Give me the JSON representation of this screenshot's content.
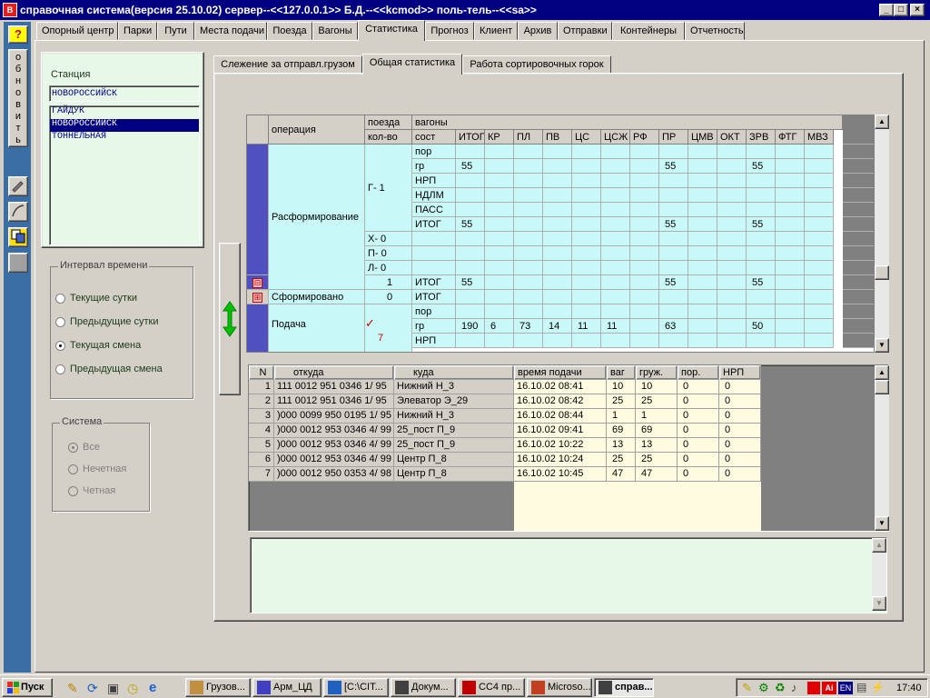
{
  "window": {
    "title": "справочная система(версия 25.10.02) сервер--<<127.0.0.1>> Б.Д.--<<kcmod>> поль-тель--<<sa>>",
    "controls": [
      "_",
      "□",
      "×"
    ]
  },
  "leftbar": {
    "help_label": "?",
    "refresh_label": "обновить"
  },
  "main_tabs": [
    "Опорный центр",
    "Парки",
    "Пути",
    "Места подачи",
    "Поезда",
    "Вагоны",
    "Статистика",
    "Прогноз",
    "Клиент",
    "Архив",
    "Отправки",
    "Контейнеры",
    "Отчетность"
  ],
  "active_main_tab": "Статистика",
  "station": {
    "label": "Станция",
    "value": "НОВОРОССИЙСК",
    "options": [
      "ГАЙДУК",
      "НОВОРОССИЙСК",
      "ТОННЕЛЬНАЯ"
    ],
    "selected": "НОВОРОССИЙСК"
  },
  "interval": {
    "caption": "Интервал времени",
    "options": [
      "Текущие сутки",
      "Предыдущие сутки",
      "Текущая смена",
      "Предыдущая смена"
    ],
    "selected": "Текущая смена"
  },
  "system": {
    "caption": "Система",
    "options": [
      "Все",
      "Нечетная",
      "Четная"
    ],
    "selected": "Все"
  },
  "sub_tabs": [
    "Слежение за отправл.грузом",
    "Общая статистика",
    "Работа сортировочных горок"
  ],
  "active_sub_tab": "Общая статистика",
  "stats": {
    "headers": {
      "operation": "операция",
      "trains": "поезда",
      "count": "кол-во",
      "wagons": "вагоны",
      "sost": "сост",
      "cols": [
        "ИТОГ",
        "КР",
        "ПЛ",
        "ПВ",
        "ЦС",
        "ЦСЖ",
        "РФ",
        "ПР",
        "ЦМВ",
        "ОКТ",
        "ЗРВ",
        "ФТГ",
        "МВЗ"
      ]
    },
    "groups": [
      {
        "operation": "Расформирование",
        "marker": "⊟"
      },
      {
        "operation": "Сформировано",
        "marker": "⊞"
      },
      {
        "operation": "Подача",
        "marker": ""
      }
    ],
    "train_counts": {
      "g": "Г-  1",
      "x": "Х-  0",
      "p": "П-  0",
      "l": "Л-  0",
      "rasform_total": "1",
      "sform_total": "0",
      "podacha_total": "7",
      "check": "✓"
    },
    "rows": [
      {
        "sost": "пор",
        "vals": [
          "",
          "",
          "",
          "",
          "",
          "",
          "",
          "",
          "",
          "",
          "",
          "",
          ""
        ]
      },
      {
        "sost": "гр",
        "vals": [
          "55",
          "",
          "",
          "",
          "",
          "",
          "",
          "55",
          "",
          "",
          "55",
          "",
          ""
        ]
      },
      {
        "sost": "НРП",
        "vals": [
          "",
          "",
          "",
          "",
          "",
          "",
          "",
          "",
          "",
          "",
          "",
          "",
          ""
        ]
      },
      {
        "sost": "НДЛМ",
        "vals": [
          "",
          "",
          "",
          "",
          "",
          "",
          "",
          "",
          "",
          "",
          "",
          "",
          ""
        ]
      },
      {
        "sost": "ПАСС",
        "vals": [
          "",
          "",
          "",
          "",
          "",
          "",
          "",
          "",
          "",
          "",
          "",
          "",
          ""
        ]
      },
      {
        "sost": "ИТОГ",
        "vals": [
          "55",
          "",
          "",
          "",
          "",
          "",
          "",
          "55",
          "",
          "",
          "55",
          "",
          ""
        ]
      },
      {
        "sost": "",
        "vals": [
          "",
          "",
          "",
          "",
          "",
          "",
          "",
          "",
          "",
          "",
          "",
          "",
          ""
        ]
      },
      {
        "sost": "",
        "vals": [
          "",
          "",
          "",
          "",
          "",
          "",
          "",
          "",
          "",
          "",
          "",
          "",
          ""
        ]
      },
      {
        "sost": "",
        "vals": [
          "",
          "",
          "",
          "",
          "",
          "",
          "",
          "",
          "",
          "",
          "",
          "",
          ""
        ]
      },
      {
        "sost": "ИТОГ",
        "vals": [
          "55",
          "",
          "",
          "",
          "",
          "",
          "",
          "55",
          "",
          "",
          "55",
          "",
          ""
        ]
      },
      {
        "sost": "ИТОГ",
        "vals": [
          "",
          "",
          "",
          "",
          "",
          "",
          "",
          "",
          "",
          "",
          "",
          "",
          ""
        ]
      },
      {
        "sost": "пор",
        "vals": [
          "",
          "",
          "",
          "",
          "",
          "",
          "",
          "",
          "",
          "",
          "",
          "",
          ""
        ]
      },
      {
        "sost": "гр",
        "vals": [
          "190",
          "6",
          "73",
          "14",
          "11",
          "11",
          "",
          "63",
          "",
          "",
          "50",
          "",
          ""
        ]
      },
      {
        "sost": "НРП",
        "vals": [
          "",
          "",
          "",
          "",
          "",
          "",
          "",
          "",
          "",
          "",
          "",
          "",
          ""
        ]
      }
    ]
  },
  "detail": {
    "headers": [
      "N",
      "откуда",
      "куда",
      "время подачи",
      "ваг",
      "груж.",
      "пор.",
      "НРП"
    ],
    "rows": [
      [
        "1",
        "111 0012 951 0346  1/ 95",
        "Нижний      Н_3",
        "16.10.02 08:41",
        "10",
        "10",
        "0",
        "0"
      ],
      [
        "2",
        "111 0012 951 0346  1/ 95",
        "Элеватор    Э_29",
        "16.10.02 08:42",
        "25",
        "25",
        "0",
        "0"
      ],
      [
        "3",
        ")000 0099 950 0195  1/ 95",
        "Нижний      Н_3",
        "16.10.02 08:44",
        "1",
        "1",
        "0",
        "0"
      ],
      [
        "4",
        ")000 0012 953 0346  4/ 99",
        "25_пост     П_9",
        "16.10.02 09:41",
        "69",
        "69",
        "0",
        "0"
      ],
      [
        "5",
        ")000 0012 953 0346  4/ 99",
        "25_пост     П_9",
        "16.10.02 10:22",
        "13",
        "13",
        "0",
        "0"
      ],
      [
        "6",
        ")000 0012 953 0346  4/ 99",
        "Центр       П_8",
        "16.10.02 10:24",
        "25",
        "25",
        "0",
        "0"
      ],
      [
        "7",
        ")000 0012 950 0353  4/ 98",
        "Центр       П_8",
        "16.10.02 10:45",
        "47",
        "47",
        "0",
        "0"
      ]
    ]
  },
  "taskbar": {
    "start": "Пуск",
    "tasks": [
      "Грузов...",
      "Арм_ЦД",
      "[C:\\CIT...",
      "Докум...",
      "СС4 пр...",
      "Microso...",
      "справ..."
    ],
    "lang": "EN",
    "clock": "17:40"
  },
  "colors": {
    "title_bg": "#000080",
    "grid_cyan": "#c8f8f8",
    "group_blue": "#5050c0",
    "panel_green": "#e8f8e8",
    "detail_yellow": "#fffbe0",
    "desktop_blue": "#3a6ea5"
  }
}
